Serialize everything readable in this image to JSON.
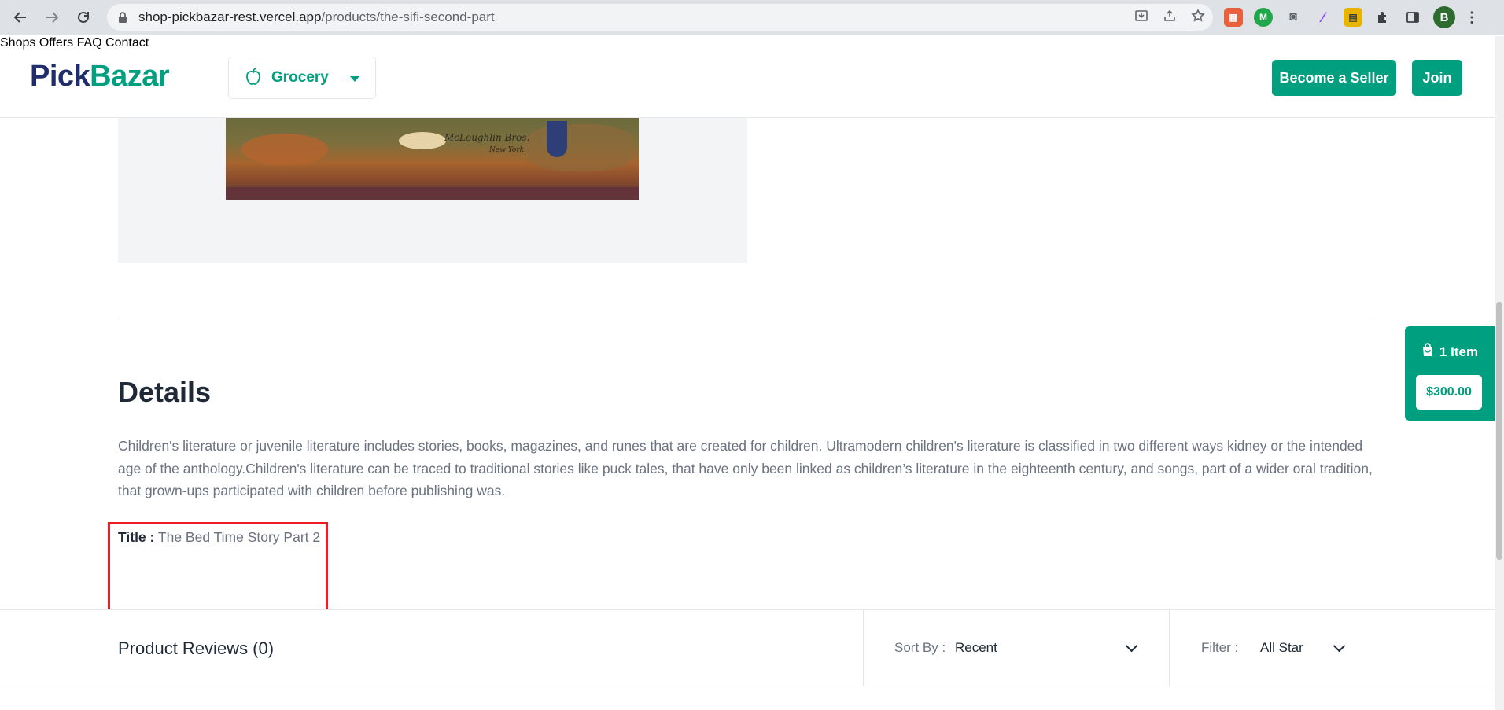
{
  "browser": {
    "url_host": "shop-pickbazar-rest.vercel.app",
    "url_path": "/products/the-sifi-second-part",
    "profile_initial": "B"
  },
  "header": {
    "logo_pick": "Pick",
    "logo_bazar": "Bazar",
    "category": "Grocery",
    "nav": [
      "Shops",
      "Offers",
      "FAQ",
      "Contact"
    ],
    "become_seller": "Become a Seller",
    "join": "Join"
  },
  "product": {
    "cover_text": "McLoughlin Bros.",
    "cover_subtext": "New York."
  },
  "details": {
    "heading": "Details",
    "description": "Children's literature or juvenile literature includes stories, books, magazines, and runes that are created for children. Ultramodern children's literature is classified in two different ways kidney or the intended age of the anthology.Children's literature can be traced to traditional stories like puck tales, that have only been linked as children’s literature in the eighteenth century, and songs, part of a wider oral tradition, that grown-ups participated with children before publishing was.",
    "title_label": "Title :",
    "title_value": "The Bed Time Story Part 2"
  },
  "reviews": {
    "title": "Product Reviews (0)",
    "sort_label": "Sort By :",
    "sort_value": "Recent",
    "filter_label": "Filter :",
    "filter_value": "All Star"
  },
  "cart": {
    "count_label": "1 Item",
    "total": "$300.00"
  },
  "colors": {
    "brand": "#009f7f",
    "logo_dark": "#1f2e6b",
    "highlight": "#ef1c24"
  }
}
